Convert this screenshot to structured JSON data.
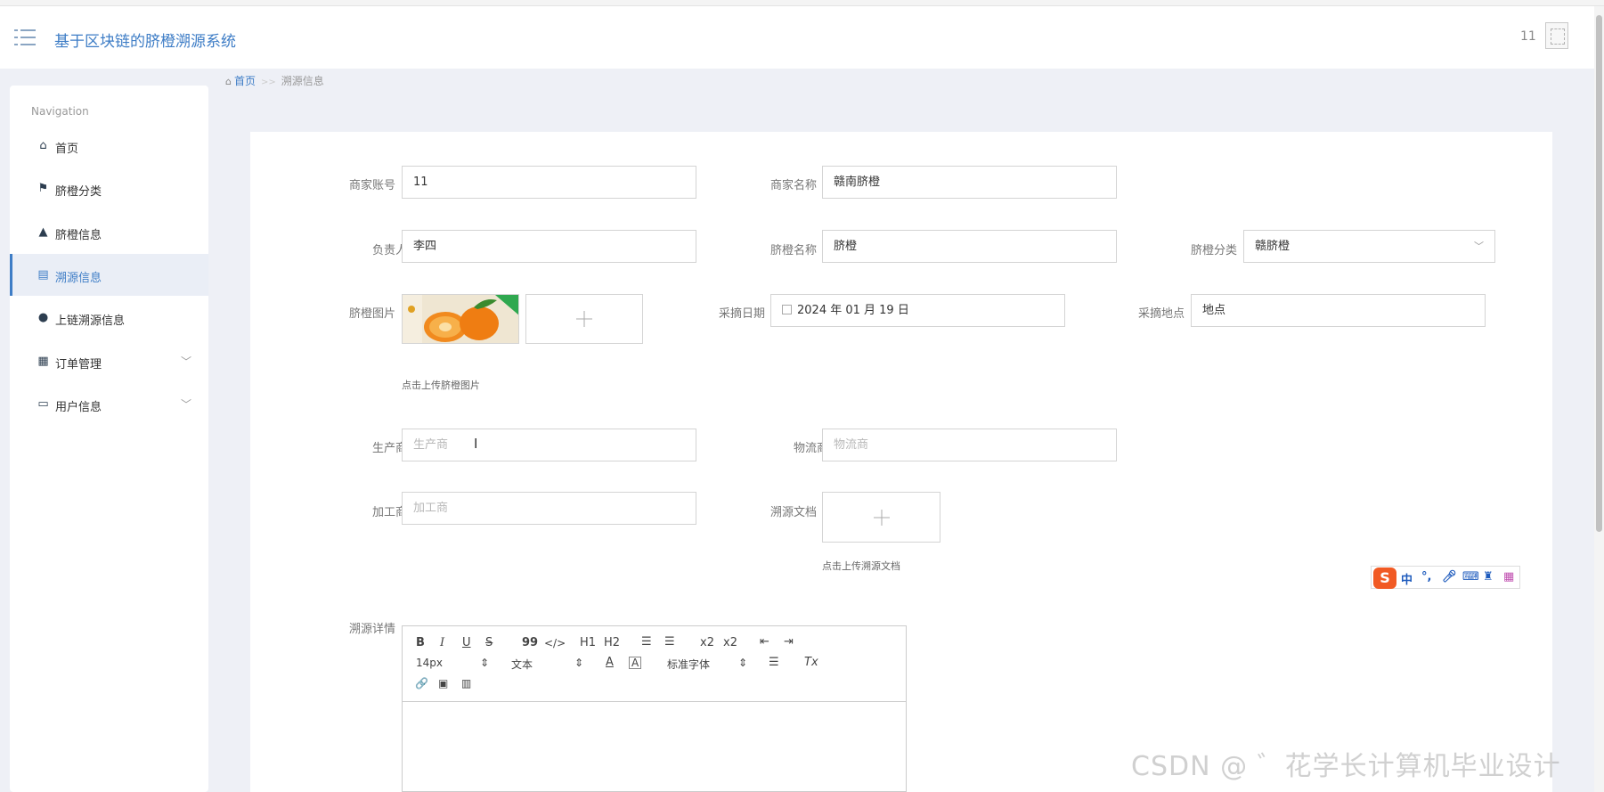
{
  "app": {
    "title": "基于区块链的脐橙溯源系统",
    "user_name": "11"
  },
  "breadcrumb": {
    "home": "首页",
    "separator": ">>",
    "current": "溯源信息"
  },
  "sidebar": {
    "heading": "Navigation",
    "items": [
      {
        "label": "首页",
        "icon": "home-icon"
      },
      {
        "label": "脐橙分类",
        "icon": "flag-icon"
      },
      {
        "label": "脐橙信息",
        "icon": "user-icon"
      },
      {
        "label": "溯源信息",
        "icon": "clipboard-icon",
        "active": true
      },
      {
        "label": "上链溯源信息",
        "icon": "pin-icon"
      },
      {
        "label": "订单管理",
        "icon": "grid-icon",
        "expandable": true
      },
      {
        "label": "用户信息",
        "icon": "card-icon",
        "expandable": true
      }
    ]
  },
  "form": {
    "merchant_account": {
      "label": "商家账号",
      "value": "11"
    },
    "merchant_name": {
      "label": "商家名称",
      "value": "赣南脐橙"
    },
    "person_in_charge": {
      "label": "负责人",
      "value": "李四"
    },
    "orange_name": {
      "label": "脐橙名称",
      "value": "脐橙"
    },
    "orange_category": {
      "label": "脐橙分类",
      "value": "赣脐橙"
    },
    "orange_image": {
      "label": "脐橙图片",
      "hint": "点击上传脐橙图片"
    },
    "pick_date": {
      "label": "采摘日期",
      "value": "2024 年 01 月 19 日"
    },
    "pick_location": {
      "label": "采摘地点",
      "value": "地点"
    },
    "producer": {
      "label": "生产商",
      "placeholder": "生产商"
    },
    "logistics": {
      "label": "物流商",
      "placeholder": "物流商"
    },
    "processor": {
      "label": "加工商",
      "placeholder": "加工商"
    },
    "trace_doc": {
      "label": "溯源文档",
      "hint": "点击上传溯源文档"
    },
    "trace_detail": {
      "label": "溯源详情"
    }
  },
  "editor": {
    "toolbar_row1": [
      "B",
      "I",
      "U",
      "S",
      "99",
      "</>",
      "H1",
      "H2",
      "ordered-list-icon",
      "bullet-list-icon",
      "x2",
      "x2",
      "outdent-icon",
      "indent-icon"
    ],
    "font_size": "14px",
    "text_type": "文本",
    "font_family": "标准字体",
    "clear_format": "Tx",
    "toolbar_row3": [
      "link-icon",
      "image-icon",
      "video-icon"
    ]
  },
  "ime": {
    "logo": "S",
    "mode": "中"
  },
  "watermark": "CSDN @ ゛花学长计算机毕业设计"
}
